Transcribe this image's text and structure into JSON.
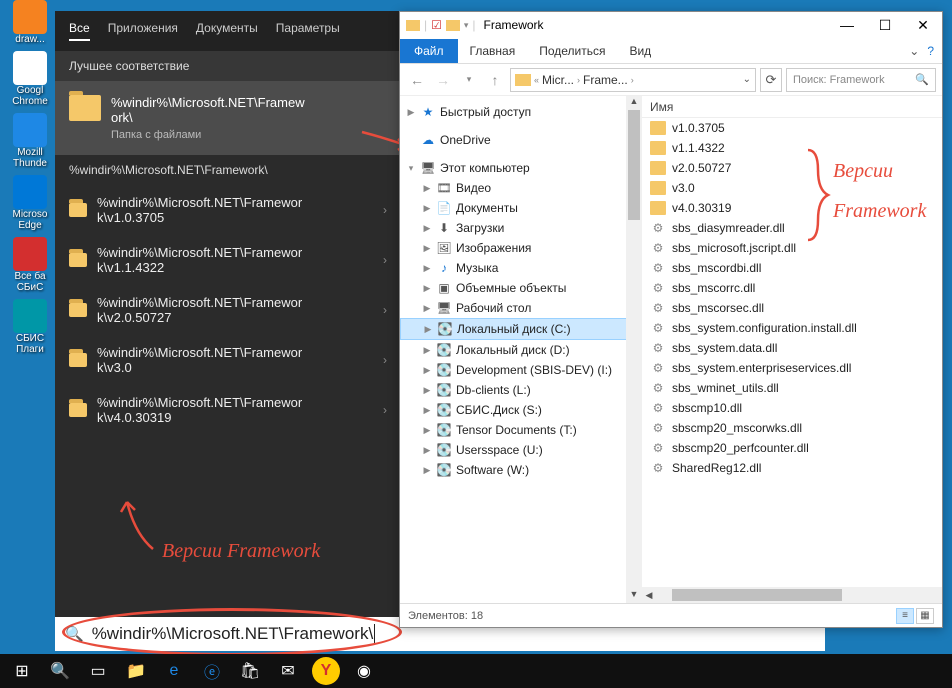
{
  "desktop": {
    "icons": [
      {
        "label": "draw...",
        "cls": "ic-orange"
      },
      {
        "label": "Googl Chrome",
        "cls": "ic-chrome"
      },
      {
        "label": "Mozill Thunde",
        "cls": "ic-blue"
      },
      {
        "label": "Microso Edge",
        "cls": "ic-edge"
      },
      {
        "label": "Все ба СБиС",
        "cls": "ic-red"
      },
      {
        "label": "СБИС Плаги",
        "cls": "ic-teal"
      }
    ]
  },
  "start": {
    "tabs": [
      "Все",
      "Приложения",
      "Документы",
      "Параметры"
    ],
    "active_tab": "Все",
    "best_match_title": "Лучшее соответствие",
    "best": {
      "title": "%windir%\\Microsoft.NET\\Framew\nork\\",
      "sub": "Папка с файлами"
    },
    "subhead": "%windir%\\Microsoft.NET\\Framework\\",
    "results": [
      "%windir%\\Microsoft.NET\\Framewor\nk\\v1.0.3705",
      "%windir%\\Microsoft.NET\\Framewor\nk\\v1.1.4322",
      "%windir%\\Microsoft.NET\\Framewor\nk\\v2.0.50727",
      "%windir%\\Microsoft.NET\\Framewor\nk\\v3.0",
      "%windir%\\Microsoft.NET\\Framewor\nk\\v4.0.30319"
    ],
    "search_value": "%windir%\\Microsoft.NET\\Framework\\"
  },
  "explorer": {
    "title": "Framework",
    "ribbon": {
      "file": "Файл",
      "tabs": [
        "Главная",
        "Поделиться",
        "Вид"
      ]
    },
    "breadcrumbs": [
      "Micr...",
      "Frame..."
    ],
    "search_placeholder": "Поиск: Framework",
    "tree": [
      {
        "label": "Быстрый доступ",
        "lv": 0,
        "icon": "★",
        "arr": "▶",
        "color": "#1976d2"
      },
      {
        "label": "OneDrive",
        "lv": 0,
        "icon": "☁",
        "arr": "",
        "color": "#1976d2"
      },
      {
        "label": "Этот компьютер",
        "lv": 0,
        "icon": "🖥",
        "arr": "▾"
      },
      {
        "label": "Видео",
        "lv": 1,
        "icon": "🎞",
        "arr": "▶"
      },
      {
        "label": "Документы",
        "lv": 1,
        "icon": "📄",
        "arr": "▶"
      },
      {
        "label": "Загрузки",
        "lv": 1,
        "icon": "⬇",
        "arr": "▶"
      },
      {
        "label": "Изображения",
        "lv": 1,
        "icon": "🖼",
        "arr": "▶"
      },
      {
        "label": "Музыка",
        "lv": 1,
        "icon": "♪",
        "arr": "▶",
        "color": "#1976d2"
      },
      {
        "label": "Объемные объекты",
        "lv": 1,
        "icon": "▣",
        "arr": "▶"
      },
      {
        "label": "Рабочий стол",
        "lv": 1,
        "icon": "🖥",
        "arr": "▶"
      },
      {
        "label": "Локальный диск (C:)",
        "lv": 1,
        "icon": "💽",
        "arr": "▶",
        "sel": true
      },
      {
        "label": "Локальный диск (D:)",
        "lv": 1,
        "icon": "💽",
        "arr": "▶"
      },
      {
        "label": "Development (SBIS-DEV) (I:)",
        "lv": 1,
        "icon": "💽",
        "arr": "▶"
      },
      {
        "label": "Db-clients (L:)",
        "lv": 1,
        "icon": "💽",
        "arr": "▶"
      },
      {
        "label": "СБИС.Диск (S:)",
        "lv": 1,
        "icon": "💽",
        "arr": "▶"
      },
      {
        "label": "Tensor Documents (T:)",
        "lv": 1,
        "icon": "💽",
        "arr": "▶"
      },
      {
        "label": "Usersspace (U:)",
        "lv": 1,
        "icon": "💽",
        "arr": "▶"
      },
      {
        "label": "Software (W:)",
        "lv": 1,
        "icon": "💽",
        "arr": "▶"
      }
    ],
    "col_head": "Имя",
    "files": [
      {
        "name": "v1.0.3705",
        "type": "folder"
      },
      {
        "name": "v1.1.4322",
        "type": "folder"
      },
      {
        "name": "v2.0.50727",
        "type": "folder"
      },
      {
        "name": "v3.0",
        "type": "folder"
      },
      {
        "name": "v4.0.30319",
        "type": "folder"
      },
      {
        "name": "sbs_diasymreader.dll",
        "type": "dll"
      },
      {
        "name": "sbs_microsoft.jscript.dll",
        "type": "dll"
      },
      {
        "name": "sbs_mscordbi.dll",
        "type": "dll"
      },
      {
        "name": "sbs_mscorrc.dll",
        "type": "dll"
      },
      {
        "name": "sbs_mscorsec.dll",
        "type": "dll"
      },
      {
        "name": "sbs_system.configuration.install.dll",
        "type": "dll"
      },
      {
        "name": "sbs_system.data.dll",
        "type": "dll"
      },
      {
        "name": "sbs_system.enterpriseservices.dll",
        "type": "dll"
      },
      {
        "name": "sbs_wminet_utils.dll",
        "type": "dll"
      },
      {
        "name": "sbscmp10.dll",
        "type": "dll"
      },
      {
        "name": "sbscmp20_mscorwks.dll",
        "type": "dll"
      },
      {
        "name": "sbscmp20_perfcounter.dll",
        "type": "dll"
      },
      {
        "name": "SharedReg12.dll",
        "type": "dll"
      }
    ],
    "status": "Элементов: 18"
  },
  "anno": {
    "left": "Версии Framework",
    "right1": "Версии",
    "right2": "Framework"
  }
}
